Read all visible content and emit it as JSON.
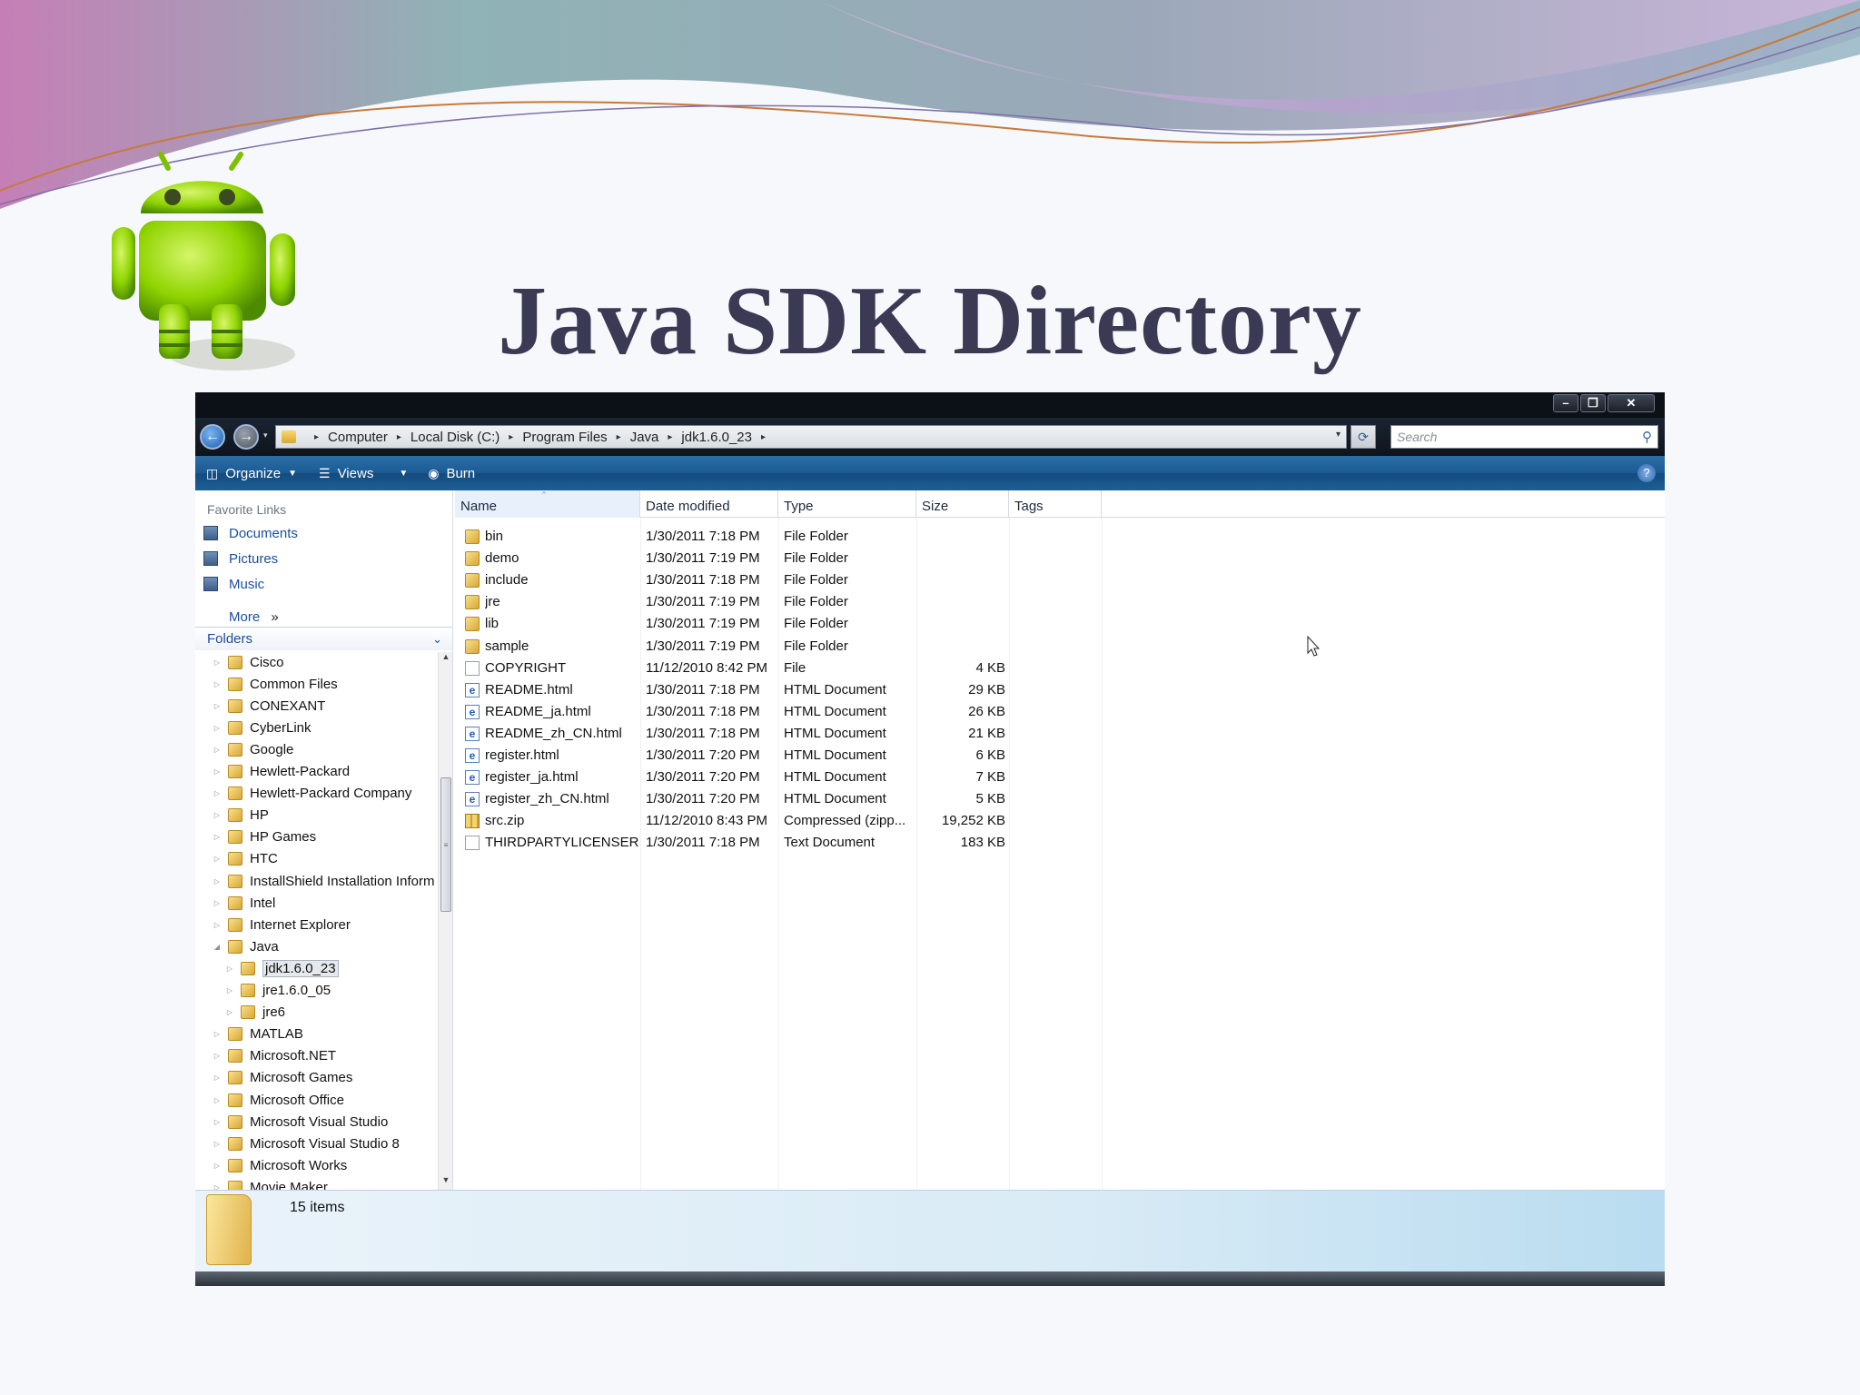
{
  "slide": {
    "title": "Java SDK Directory"
  },
  "window": {
    "controls": {
      "minimize": "–",
      "maximize": "❐",
      "close": "✕"
    }
  },
  "nav": {
    "back": "←",
    "forward": "→",
    "dropdown": "▾"
  },
  "address": {
    "crumbs": [
      "Computer",
      "Local Disk (C:)",
      "Program Files",
      "Java",
      "jdk1.6.0_23"
    ],
    "separator": "▸",
    "dropdown": "▾",
    "refresh": "⟳"
  },
  "search": {
    "placeholder": "Search",
    "icon": "search-icon"
  },
  "toolbar": {
    "organize": "Organize",
    "views": "Views",
    "burn": "Burn",
    "help": "?"
  },
  "sidebar": {
    "favorites_heading": "Favorite Links",
    "favorites": [
      "Documents",
      "Pictures",
      "Music"
    ],
    "more": "More",
    "more_glyph": "»",
    "folders_heading": "Folders",
    "folders_chevron": "⌄",
    "tree": [
      {
        "label": "Cisco",
        "level": 1,
        "toggle": "▷"
      },
      {
        "label": "Common Files",
        "level": 1,
        "toggle": "▷"
      },
      {
        "label": "CONEXANT",
        "level": 1,
        "toggle": "▷"
      },
      {
        "label": "CyberLink",
        "level": 1,
        "toggle": "▷"
      },
      {
        "label": "Google",
        "level": 1,
        "toggle": "▷"
      },
      {
        "label": "Hewlett-Packard",
        "level": 1,
        "toggle": "▷"
      },
      {
        "label": "Hewlett-Packard Company",
        "level": 1,
        "toggle": "▷"
      },
      {
        "label": "HP",
        "level": 1,
        "toggle": "▷"
      },
      {
        "label": "HP Games",
        "level": 1,
        "toggle": "▷"
      },
      {
        "label": "HTC",
        "level": 1,
        "toggle": "▷"
      },
      {
        "label": "InstallShield Installation Inform",
        "level": 1,
        "toggle": "▷"
      },
      {
        "label": "Intel",
        "level": 1,
        "toggle": "▷"
      },
      {
        "label": "Internet Explorer",
        "level": 1,
        "toggle": "▷"
      },
      {
        "label": "Java",
        "level": 1,
        "toggle": "◢"
      },
      {
        "label": "jdk1.6.0_23",
        "level": 2,
        "toggle": "▷",
        "selected": true
      },
      {
        "label": "jre1.6.0_05",
        "level": 2,
        "toggle": "▷"
      },
      {
        "label": "jre6",
        "level": 2,
        "toggle": "▷"
      },
      {
        "label": "MATLAB",
        "level": 1,
        "toggle": "▷"
      },
      {
        "label": "Microsoft.NET",
        "level": 1,
        "toggle": "▷"
      },
      {
        "label": "Microsoft Games",
        "level": 1,
        "toggle": "▷"
      },
      {
        "label": "Microsoft Office",
        "level": 1,
        "toggle": "▷"
      },
      {
        "label": "Microsoft Visual Studio",
        "level": 1,
        "toggle": "▷"
      },
      {
        "label": "Microsoft Visual Studio 8",
        "level": 1,
        "toggle": "▷"
      },
      {
        "label": "Microsoft Works",
        "level": 1,
        "toggle": "▷"
      },
      {
        "label": "Movie Maker",
        "level": 1,
        "toggle": "▷"
      }
    ],
    "scroll_up": "▲",
    "scroll_down": "▼",
    "scroll_grip": "≡"
  },
  "file_list": {
    "columns": [
      "Name",
      "Date modified",
      "Type",
      "Size",
      "Tags"
    ],
    "sort_glyph": "^",
    "rows": [
      {
        "name": "bin",
        "date": "1/30/2011 7:18 PM",
        "type": "File Folder",
        "size": "",
        "icon": "folder"
      },
      {
        "name": "demo",
        "date": "1/30/2011 7:19 PM",
        "type": "File Folder",
        "size": "",
        "icon": "folder"
      },
      {
        "name": "include",
        "date": "1/30/2011 7:18 PM",
        "type": "File Folder",
        "size": "",
        "icon": "folder"
      },
      {
        "name": "jre",
        "date": "1/30/2011 7:19 PM",
        "type": "File Folder",
        "size": "",
        "icon": "folder"
      },
      {
        "name": "lib",
        "date": "1/30/2011 7:19 PM",
        "type": "File Folder",
        "size": "",
        "icon": "folder"
      },
      {
        "name": "sample",
        "date": "1/30/2011 7:19 PM",
        "type": "File Folder",
        "size": "",
        "icon": "folder"
      },
      {
        "name": "COPYRIGHT",
        "date": "11/12/2010 8:42 PM",
        "type": "File",
        "size": "4 KB",
        "icon": "file"
      },
      {
        "name": "README.html",
        "date": "1/30/2011 7:18 PM",
        "type": "HTML Document",
        "size": "29 KB",
        "icon": "html"
      },
      {
        "name": "README_ja.html",
        "date": "1/30/2011 7:18 PM",
        "type": "HTML Document",
        "size": "26 KB",
        "icon": "html"
      },
      {
        "name": "README_zh_CN.html",
        "date": "1/30/2011 7:18 PM",
        "type": "HTML Document",
        "size": "21 KB",
        "icon": "html"
      },
      {
        "name": "register.html",
        "date": "1/30/2011 7:20 PM",
        "type": "HTML Document",
        "size": "6 KB",
        "icon": "html"
      },
      {
        "name": "register_ja.html",
        "date": "1/30/2011 7:20 PM",
        "type": "HTML Document",
        "size": "7 KB",
        "icon": "html"
      },
      {
        "name": "register_zh_CN.html",
        "date": "1/30/2011 7:20 PM",
        "type": "HTML Document",
        "size": "5 KB",
        "icon": "html"
      },
      {
        "name": "src.zip",
        "date": "11/12/2010 8:43 PM",
        "type": "Compressed (zipp...",
        "size": "19,252 KB",
        "icon": "zip"
      },
      {
        "name": "THIRDPARTYLICENSER...",
        "date": "1/30/2011 7:18 PM",
        "type": "Text Document",
        "size": "183 KB",
        "icon": "file"
      }
    ]
  },
  "details": {
    "item_count": "15 items"
  },
  "colors": {
    "title": "#3a3a55",
    "link": "#1b4f9c",
    "command_bar": "#1b5a92",
    "android_green": "#8fd400"
  }
}
